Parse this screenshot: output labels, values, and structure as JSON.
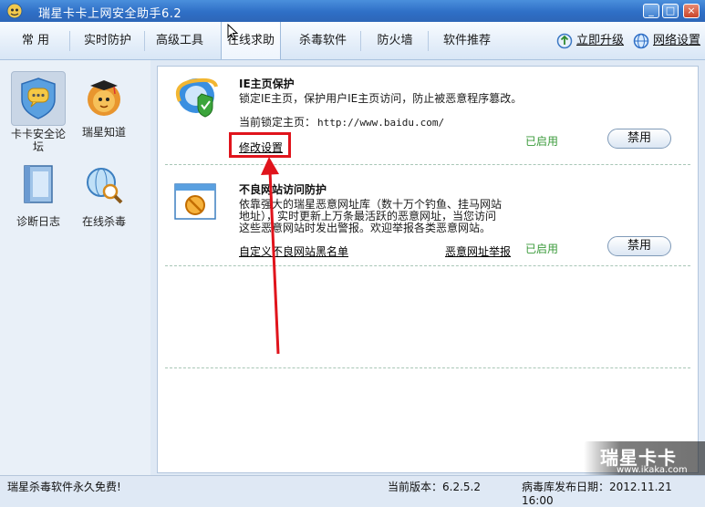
{
  "window": {
    "title": "瑞星卡卡上网安全助手6.2",
    "min_label": "_",
    "max_label": "□",
    "close_label": "×"
  },
  "tabs": [
    {
      "label": "常  用"
    },
    {
      "label": "实时防护"
    },
    {
      "label": "高级工具"
    },
    {
      "label": "在线求助",
      "active": true
    },
    {
      "label": "杀毒软件"
    },
    {
      "label": "防火墙"
    },
    {
      "label": "软件推荐"
    }
  ],
  "top_links": {
    "upgrade": "立即升级",
    "network_settings": "网络设置"
  },
  "sidebar": {
    "items": [
      {
        "label": "卡卡安全论坛",
        "icon": "forum-chat-icon",
        "selected": true
      },
      {
        "label": "瑞星知道",
        "icon": "mascot-lion-icon"
      },
      {
        "label": "诊断日志",
        "icon": "log-book-icon"
      },
      {
        "label": "在线杀毒",
        "icon": "online-scan-icon"
      }
    ]
  },
  "sections": [
    {
      "title": "IE主页保护",
      "desc_lines": [
        "锁定IE主页，保护用户IE主页访问，防止被恶意程序篡改。"
      ],
      "current_home_label": "当前锁定主页：",
      "current_home_value": "http://www.baidu.com/",
      "link1": "修改设置",
      "status": "已启用",
      "button": "禁用",
      "icon": "ie-shield-icon"
    },
    {
      "title": "不良网站访问防护",
      "desc_lines": [
        "依靠强大的瑞星恶意网址库（数十万个钓鱼、挂马网站",
        "地址），实时更新上万条最活跃的恶意网址，当您访问",
        "这些恶意网站时发出警报。欢迎举报各类恶意网站。"
      ],
      "link1": "自定义不良网站黑名单",
      "link2": "恶意网址举报",
      "status": "已启用",
      "button": "禁用",
      "icon": "blocked-site-icon"
    }
  ],
  "statusbar": {
    "left": "瑞星杀毒软件永久免费!",
    "version": "当前版本：6.2.5.2",
    "virus_db": "病毒库发布日期：2012.11.21 16:00"
  },
  "watermark": {
    "brand": "瑞星卡卡",
    "url": "www.ikaka.com"
  },
  "colors": {
    "status_green": "#3a9a3a",
    "highlight_red": "#e0141c"
  }
}
